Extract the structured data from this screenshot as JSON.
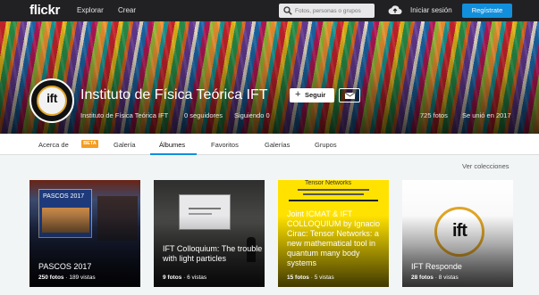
{
  "header": {
    "logo": "flickr",
    "nav": [
      "Explorar",
      "Crear"
    ],
    "search_placeholder": "Fotos, personas o grupos",
    "login": "Iniciar sesión",
    "register": "Regístrate"
  },
  "profile": {
    "avatar_text": "ift",
    "name": "Instituto de Física Teórica IFT",
    "follow_label": "Seguir",
    "username": "Instituto de Física Teórica IFT",
    "followers": "0 seguidores",
    "following": "Siguiendo 0",
    "photos": "725 fotos",
    "joined": "Se unió en 2017"
  },
  "tabs": {
    "about": "Acerca de",
    "beta": "BETA",
    "gallery": "Galería",
    "albums": "Álbumes",
    "favorites": "Favoritos",
    "galleries": "Galerías",
    "groups": "Grupos"
  },
  "view_collections": "Ver colecciones",
  "albums": [
    {
      "title": "PASCOS 2017",
      "photos": "250 fotos",
      "views": "189 vistas",
      "cover_text": "PASCOS 2017"
    },
    {
      "title": "IFT Colloquium: The trouble with light particles",
      "photos": "9 fotos",
      "views": "6 vistas"
    },
    {
      "title": "Joint ICMAT & IFT COLLOQUIUM by Ignacio Cirac: Tensor Networks: a new mathematical tool in quantum many body systems",
      "photos": "15 fotos",
      "views": "5 vistas",
      "cover_text": "Tensor Networks"
    },
    {
      "title": "IFT Responde",
      "photos": "28 fotos",
      "views": "8 vistas",
      "cover_text": "ift"
    }
  ],
  "colors": {
    "accent": "#128fdc",
    "topbar": "#212124",
    "beta": "#f59c22"
  }
}
